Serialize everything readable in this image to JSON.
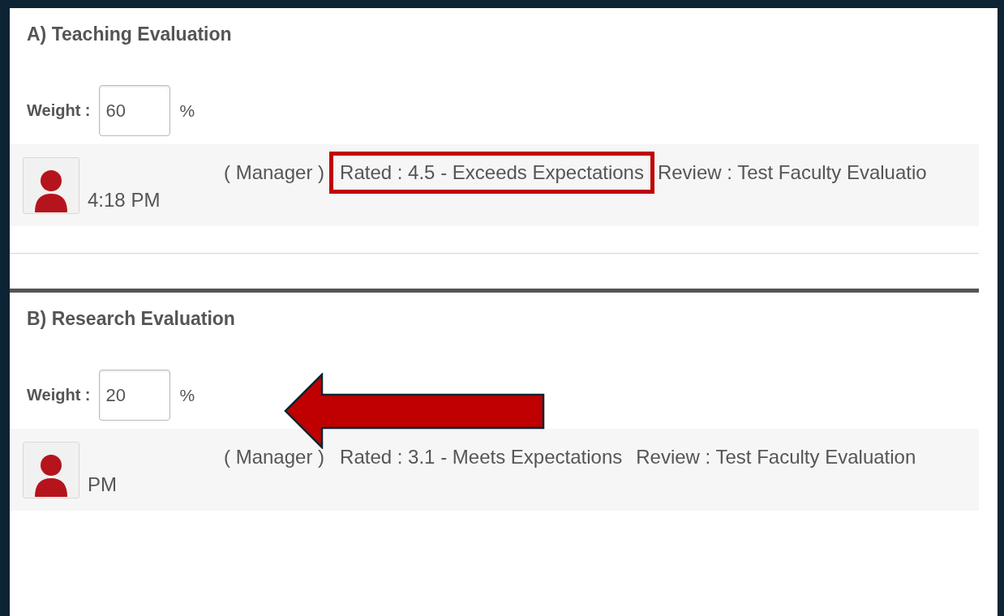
{
  "sections": [
    {
      "title": "A) Teaching Evaluation",
      "weight": {
        "label": "Weight :",
        "value": "60",
        "unit": "%",
        "pointed_at": false
      },
      "review": {
        "role": "( Manager )",
        "rating": "Rated : 4.5 - Exceeds Expectations",
        "highlighted": true,
        "review": "Review : Test Faculty Evaluatio",
        "time": "4:18 PM"
      }
    },
    {
      "title": "B) Research Evaluation",
      "weight": {
        "label": "Weight :",
        "value": "20",
        "unit": "%",
        "pointed_at": true
      },
      "review": {
        "role": "( Manager )",
        "rating": "Rated : 3.1 - Meets Expectations",
        "highlighted": false,
        "review": "Review : Test Faculty Evaluation",
        "time": "PM"
      }
    }
  ]
}
